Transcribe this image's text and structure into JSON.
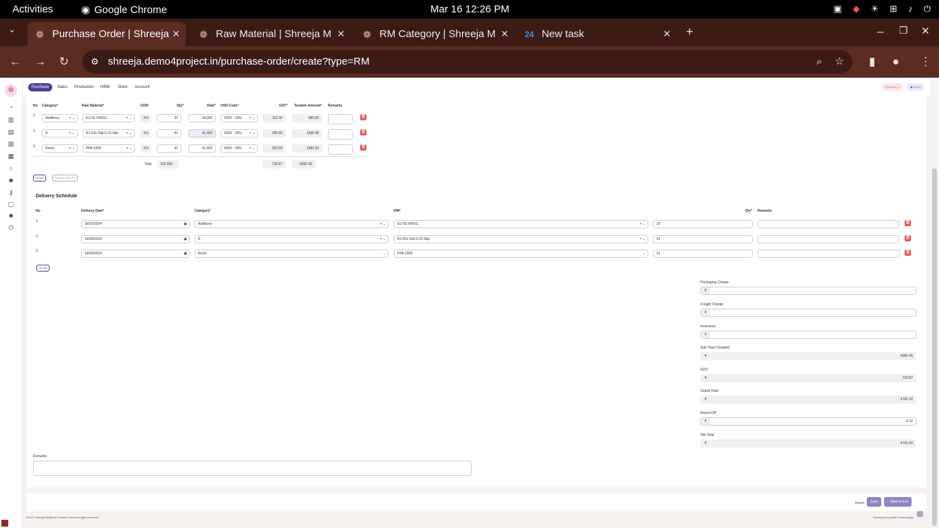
{
  "os": {
    "activities": "Activities",
    "app": "Google Chrome",
    "clock": "Mar 16  12:26 PM"
  },
  "tabs": [
    {
      "title": "Purchase Order | Shreeja",
      "active": true
    },
    {
      "title": "Raw Material | Shreeja M"
    },
    {
      "title": "RM Category | Shreeja M"
    },
    {
      "title": "New task"
    }
  ],
  "url": "shreeja.demo4project.in/purchase-order/create?type=RM",
  "nav": [
    "Purchase",
    "Sales",
    "Production",
    "HRM",
    "Store",
    "Account"
  ],
  "top_right": [
    "Factory 1",
    "23-24"
  ],
  "items": {
    "headers": [
      "No",
      "Category*",
      "Raw Material*",
      "UOM",
      "Qty*",
      "Rate*",
      "HSN Code*",
      "GST*",
      "Taxable Amount*",
      "Remarks"
    ],
    "rows": [
      {
        "no": "1.",
        "category": "Additives",
        "rm": "ELITE 5401G",
        "uom": "KG",
        "qty": "20",
        "rate": "34.000",
        "hsn": "9033 - 18%",
        "gst": "122.40",
        "taxable": "680.00"
      },
      {
        "no": "2.",
        "category": "R",
        "rm": "R1-RG-Slip-0.22-Slip",
        "uom": "KG",
        "qty": "41",
        "rate": "41.450",
        "hsn": "9033 - 18%",
        "gst": "305.90",
        "taxable": "1699.45"
      },
      {
        "no": "3.",
        "category": "Resin",
        "rm": "PPA 2308",
        "uom": "KG",
        "qty": "41",
        "rate": "41.000",
        "hsn": "9033 - 18%",
        "gst": "302.58",
        "taxable": "1681.00"
      }
    ],
    "total_label": "Total",
    "total_qty": "102.000",
    "total_gst": "730.87",
    "total_taxable": "4060.45",
    "add": "Add",
    "add_related": "Relieve Bulk DS"
  },
  "delivery": {
    "title": "Delivery Schedule",
    "headers": [
      "No",
      "Delivery Date*",
      "Category*",
      "RM*",
      "Qty*",
      "Remarks"
    ],
    "rows": [
      {
        "no": "1.",
        "date": "16/03/2024",
        "category": "Additives",
        "rm": "ELITE 5401G",
        "qty": "20"
      },
      {
        "no": "2.",
        "date": "16/03/2024",
        "category": "R",
        "rm": "R1-RG-Slip-0.22-Slip",
        "qty": "41"
      },
      {
        "no": "3.",
        "date": "16/03/2024",
        "category": "Resin",
        "rm": "PPA 2308",
        "qty": "41"
      }
    ],
    "add": "Add"
  },
  "summary": [
    {
      "label": "Packaging Charge",
      "value": "",
      "ro": false
    },
    {
      "label": "Freight Charge",
      "value": "",
      "ro": false
    },
    {
      "label": "Insurance",
      "value": "",
      "ro": false
    },
    {
      "label": "Sub Total (Taxable)",
      "value": "4060.45",
      "ro": true
    },
    {
      "label": "IGST",
      "value": "730.87",
      "ro": true
    },
    {
      "label": "Grand Total",
      "value": "4791.32",
      "ro": true
    },
    {
      "label": "Round Off",
      "value": "-0.32",
      "ro": false
    },
    {
      "label": "Net Total",
      "value": "4791.00",
      "ro": true
    }
  ],
  "currency": "₹",
  "remarks_label": "Remarks",
  "actions": {
    "reset": "Reset",
    "save": "Save",
    "save_exit": "Save & Exit"
  },
  "footer": {
    "left": "2024© Shreeja Multifilms Private Limited All rights reserved.",
    "dev": "Developed by",
    "company": "MNS Technologies"
  }
}
